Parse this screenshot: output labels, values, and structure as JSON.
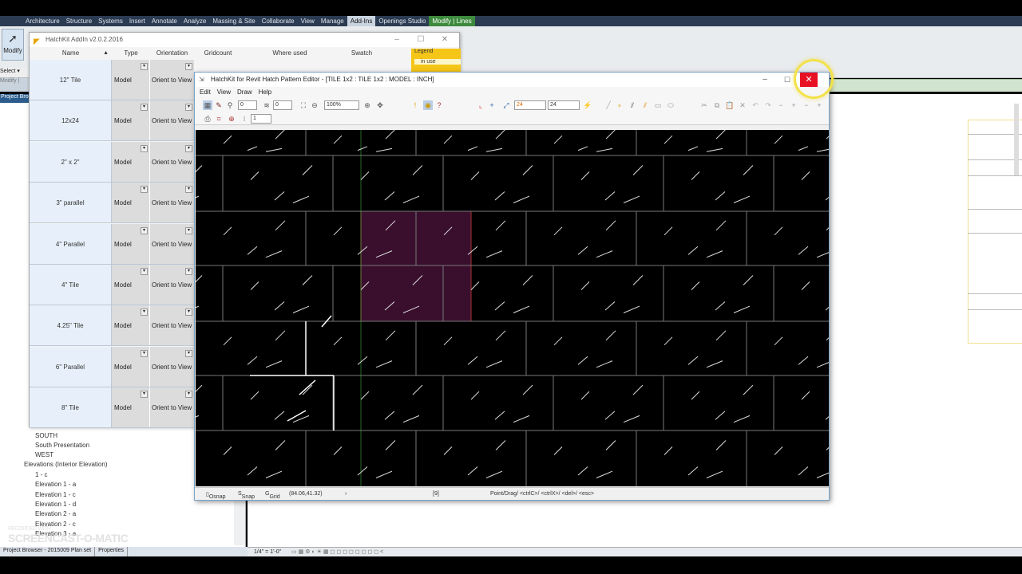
{
  "revit": {
    "tabs": [
      "Architecture",
      "Structure",
      "Systems",
      "Insert",
      "Annotate",
      "Analyze",
      "Massing & Site",
      "Collaborate",
      "View",
      "Manage",
      "Add-Ins",
      "Openings Studio",
      "Modify | Lines"
    ],
    "modify_label": "Modify",
    "select_label": "Select",
    "left_strip_label": "Modify |",
    "project_browser_label": "Project Bro",
    "browser_items": [
      "SOUTH",
      "South Presentation",
      "WEST",
      "Elevations (Interior Elevation)",
      "1 - c",
      "Elevation 1 - a",
      "Elevation 1 - c",
      "Elevation 1 - d",
      "Elevation 2 - a",
      "Elevation 2 - c",
      "Elevation 3 - a"
    ],
    "bottom_tabs": [
      "Project Browser - 2015009 Plan set",
      "Properties"
    ],
    "scale_label": "1/4\" = 1'-0\"",
    "watermark_top": "RECORDED WITH",
    "watermark": "SCREENCAST-O-MATIC"
  },
  "addin": {
    "title": "HatchKit AddIn v2.0.2.2016",
    "columns": [
      "Name",
      "Type",
      "Orientation",
      "Gridcount",
      "Where used",
      "Swatch"
    ],
    "legend_label": "Legend",
    "in_use_label": "in use",
    "rows": [
      {
        "name": "12\" Tile",
        "type": "Model",
        "orientation": "Orient to View"
      },
      {
        "name": "12x24",
        "type": "Model",
        "orientation": "Orient to View"
      },
      {
        "name": "2\" x 2\"",
        "type": "Model",
        "orientation": "Orient to View"
      },
      {
        "name": "3\" parallel",
        "type": "Model",
        "orientation": "Orient to View"
      },
      {
        "name": "4\" Parallel",
        "type": "Model",
        "orientation": "Orient to View"
      },
      {
        "name": "4\" Tile",
        "type": "Model",
        "orientation": "Orient to View"
      },
      {
        "name": "4.25\" Tile",
        "type": "Model",
        "orientation": "Orient to View"
      },
      {
        "name": "6\" Parallel",
        "type": "Model",
        "orientation": "Orient to View"
      },
      {
        "name": "8\" Tile",
        "type": "Model",
        "orientation": "Orient to View"
      }
    ]
  },
  "editor": {
    "title": "HatchKit for Revit Hatch Pattern Editor - [TILE 1x2 : TILE 1x2 : MODEL : INCH]",
    "menu": [
      "Edit",
      "View",
      "Draw",
      "Help"
    ],
    "field_a": "0",
    "field_b": "0",
    "zoom": "100%",
    "grid_x": "24",
    "grid_y": "24",
    "field_c": "1",
    "status": {
      "osnap": "Osnap",
      "snap": "Snap",
      "grid": "Grid",
      "coords": "(84.06,41.32)",
      "count": "[9]",
      "hint": "Point/Drag/ <ctrlC>/ <ctrlX>/ <del>/ <esc>"
    }
  }
}
